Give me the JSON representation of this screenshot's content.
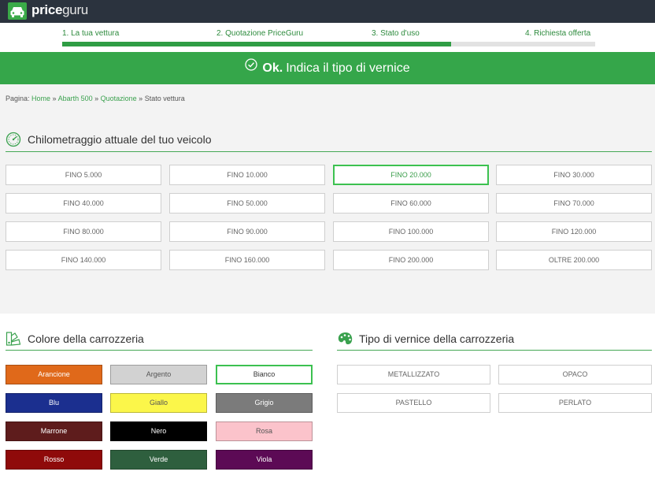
{
  "brand": {
    "name_a": "price",
    "name_b": "guru"
  },
  "steps": [
    {
      "label": "1.  La tua vettura"
    },
    {
      "label": "2.  Quotazione PriceGuru"
    },
    {
      "label": "3.  Stato d'uso"
    },
    {
      "label": "4.  Richiesta offerta"
    }
  ],
  "progress": {
    "value": 0.73
  },
  "banner": {
    "ok": "Ok.",
    "text": "Indica il tipo di vernice"
  },
  "breadcrumb": {
    "prefix": "Pagina: ",
    "links": [
      "Home",
      "Abarth 500",
      "Quotazione"
    ],
    "separator": " » ",
    "current": "Stato vettura"
  },
  "mileage": {
    "title": "Chilometraggio attuale del tuo veicolo",
    "options": [
      "FINO 5.000",
      "FINO 10.000",
      "FINO 20.000",
      "FINO 30.000",
      "FINO 40.000",
      "FINO 50.000",
      "FINO 60.000",
      "FINO 70.000",
      "FINO 80.000",
      "FINO 90.000",
      "FINO 100.000",
      "FINO 120.000",
      "FINO 140.000",
      "FINO 160.000",
      "FINO 200.000",
      "OLTRE 200.000"
    ],
    "selected": "FINO 20.000"
  },
  "body_color": {
    "title": "Colore della carrozzeria",
    "options": [
      {
        "label": "Arancione",
        "bg": "#e0691a",
        "fg": "#ffffff"
      },
      {
        "label": "Argento",
        "bg": "#d2d2d2",
        "fg": "#555555"
      },
      {
        "label": "Bianco",
        "bg": "#ffffff",
        "fg": "#333333"
      },
      {
        "label": "Blu",
        "bg": "#1b2f8f",
        "fg": "#ffffff"
      },
      {
        "label": "Giallo",
        "bg": "#fbf64a",
        "fg": "#555555"
      },
      {
        "label": "Grigio",
        "bg": "#7b7b7b",
        "fg": "#ffffff"
      },
      {
        "label": "Marrone",
        "bg": "#5e1c1c",
        "fg": "#ffffff"
      },
      {
        "label": "Nero",
        "bg": "#000000",
        "fg": "#ffffff"
      },
      {
        "label": "Rosa",
        "bg": "#fbc3cb",
        "fg": "#555555"
      },
      {
        "label": "Rosso",
        "bg": "#8f0a0a",
        "fg": "#ffffff"
      },
      {
        "label": "Verde",
        "bg": "#2e5f3e",
        "fg": "#ffffff"
      },
      {
        "label": "Viola",
        "bg": "#5c0a55",
        "fg": "#ffffff"
      }
    ],
    "selected": "Bianco"
  },
  "paint_type": {
    "title": "Tipo di vernice della carrozzeria",
    "options": [
      "METALLIZZATO",
      "OPACO",
      "PASTELLO",
      "PERLATO"
    ]
  },
  "colors": {
    "accent": "#35a64a",
    "topbar": "#2b333e",
    "selected_border": "#3cc150"
  }
}
